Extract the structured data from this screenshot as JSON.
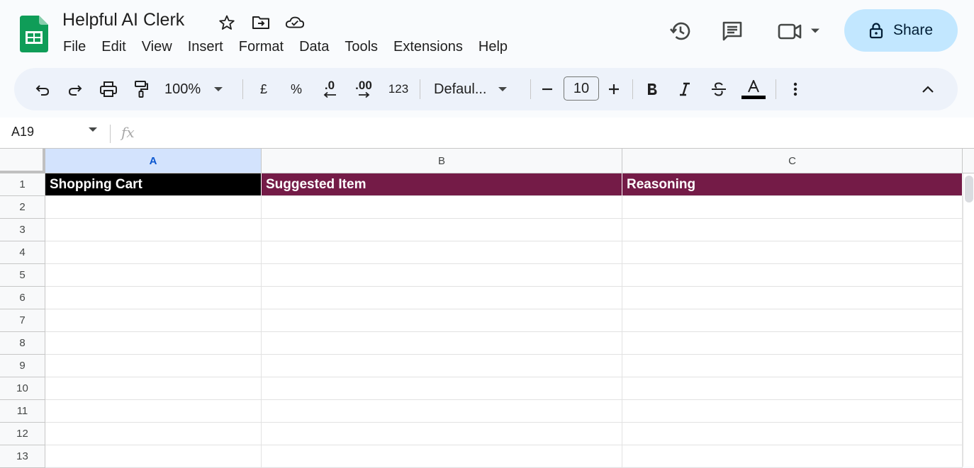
{
  "app": {
    "doc_title": "Helpful AI Clerk"
  },
  "menu": [
    "File",
    "Edit",
    "View",
    "Insert",
    "Format",
    "Data",
    "Tools",
    "Extensions",
    "Help"
  ],
  "share": {
    "label": "Share"
  },
  "toolbar": {
    "zoom": "100%",
    "currency": "£",
    "percent": "%",
    "decrease_decimal": ".0",
    "increase_decimal": ".00",
    "number_format": "123",
    "font": "Defaul...",
    "font_size": "10"
  },
  "formula_bar": {
    "name_box": "A19",
    "fx": "fx",
    "value": ""
  },
  "sheet": {
    "columns": [
      "A",
      "B",
      "C"
    ],
    "selected_column": "A",
    "rows": [
      "1",
      "2",
      "3",
      "4",
      "5",
      "6",
      "7",
      "8",
      "9",
      "10",
      "11",
      "12",
      "13"
    ],
    "header_row": [
      "Shopping Cart",
      "Suggested Item",
      "Reasoning"
    ]
  },
  "colors": {
    "header_a": "#000000",
    "header_bc": "#741b47",
    "share_bg": "#c2e7ff",
    "toolbar_bg": "#edf2fa",
    "sheets_green": "#0f9d58"
  }
}
